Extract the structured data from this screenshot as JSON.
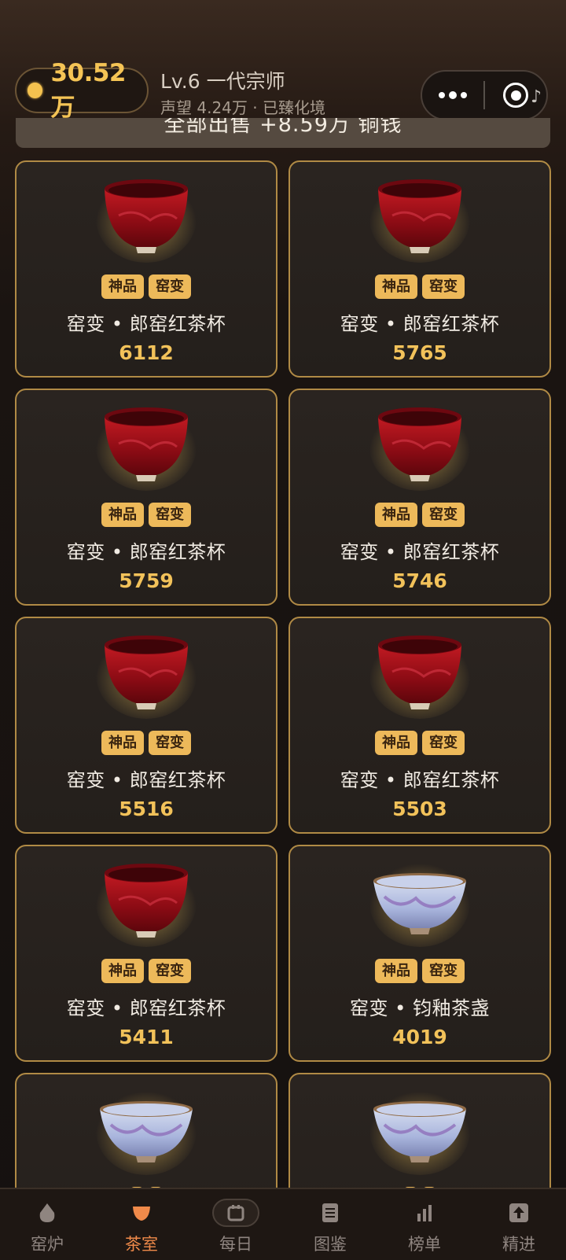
{
  "header": {
    "coins": "30.52万",
    "level_title": "Lv.6 一代宗师",
    "level_sub": "声望 4.24万 · 已臻化境",
    "banner_text": "全部出售 +8.59万 铜钱"
  },
  "capsule": {
    "more_icon": "more-dots-icon",
    "close_icon": "target-close-icon"
  },
  "colors": {
    "gold": "#f2c25a",
    "card_border": "#b08a45",
    "tag_bg": "#edb95a",
    "active_nav": "#f08a4a",
    "cup_red": "#9b0d16",
    "cup_blue": "#b9c6e6"
  },
  "items": [
    {
      "tags": [
        "神品",
        "窑变"
      ],
      "name": "窑变 • 郎窑红茶杯",
      "price": "6112",
      "style": "red"
    },
    {
      "tags": [
        "神品",
        "窑变"
      ],
      "name": "窑变 • 郎窑红茶杯",
      "price": "5765",
      "style": "red"
    },
    {
      "tags": [
        "神品",
        "窑变"
      ],
      "name": "窑变 • 郎窑红茶杯",
      "price": "5759",
      "style": "red"
    },
    {
      "tags": [
        "神品",
        "窑变"
      ],
      "name": "窑变 • 郎窑红茶杯",
      "price": "5746",
      "style": "red"
    },
    {
      "tags": [
        "神品",
        "窑变"
      ],
      "name": "窑变 • 郎窑红茶杯",
      "price": "5516",
      "style": "red"
    },
    {
      "tags": [
        "神品",
        "窑变"
      ],
      "name": "窑变 • 郎窑红茶杯",
      "price": "5503",
      "style": "red"
    },
    {
      "tags": [
        "神品",
        "窑变"
      ],
      "name": "窑变 • 郎窑红茶杯",
      "price": "5411",
      "style": "red"
    },
    {
      "tags": [
        "神品",
        "窑变"
      ],
      "name": "窑变 • 钧釉茶盏",
      "price": "4019",
      "style": "blue"
    },
    {
      "tags": [
        "",
        ""
      ],
      "name": "",
      "price": "",
      "style": "blue"
    },
    {
      "tags": [
        "",
        ""
      ],
      "name": "",
      "price": "",
      "style": "blue"
    }
  ],
  "nav": [
    {
      "label": "窑炉",
      "icon": "kiln-icon",
      "active": false
    },
    {
      "label": "茶室",
      "icon": "tea-cup-icon",
      "active": true
    },
    {
      "label": "每日",
      "icon": "calendar-icon",
      "active": false
    },
    {
      "label": "图鉴",
      "icon": "catalog-icon",
      "active": false
    },
    {
      "label": "榜单",
      "icon": "ranking-icon",
      "active": false
    },
    {
      "label": "精进",
      "icon": "upgrade-icon",
      "active": false
    }
  ]
}
